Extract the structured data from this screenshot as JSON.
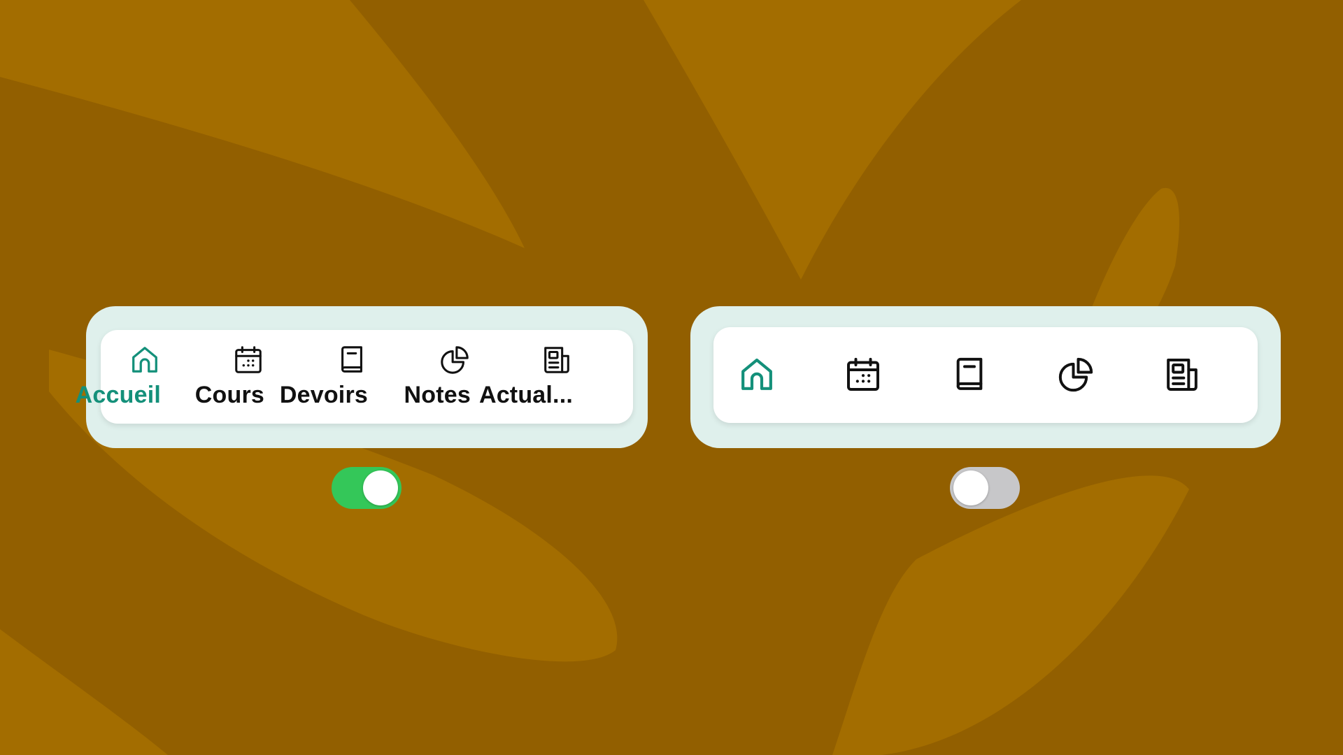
{
  "colors": {
    "background": "#925f00",
    "background_shape": "#a36d00",
    "panel": "#dff0ec",
    "card": "#ffffff",
    "accent": "#14907a",
    "icon_default": "#111111",
    "toggle_on": "#34c759",
    "toggle_off": "#c7c7c9"
  },
  "labeled_tab_bar": {
    "active_tab": "Accueil",
    "tabs": [
      {
        "label": "Accueil",
        "icon": "home-icon",
        "active": true
      },
      {
        "label": "Cours",
        "icon": "calendar-icon",
        "active": false
      },
      {
        "label": "Devoirs",
        "icon": "book-icon",
        "active": false
      },
      {
        "label": "Notes",
        "icon": "pie-chart-icon",
        "active": false
      },
      {
        "label": "Actual...",
        "icon": "newspaper-icon",
        "active": false
      }
    ]
  },
  "icon_only_tab_bar": {
    "active_tab": "home",
    "tabs": [
      {
        "icon": "home-icon",
        "active": true
      },
      {
        "icon": "calendar-icon",
        "active": false
      },
      {
        "icon": "book-icon",
        "active": false
      },
      {
        "icon": "pie-chart-icon",
        "active": false
      },
      {
        "icon": "newspaper-icon",
        "active": false
      }
    ]
  },
  "toggles": {
    "labels_toggle_left": {
      "state": "on"
    },
    "labels_toggle_right": {
      "state": "off"
    }
  }
}
